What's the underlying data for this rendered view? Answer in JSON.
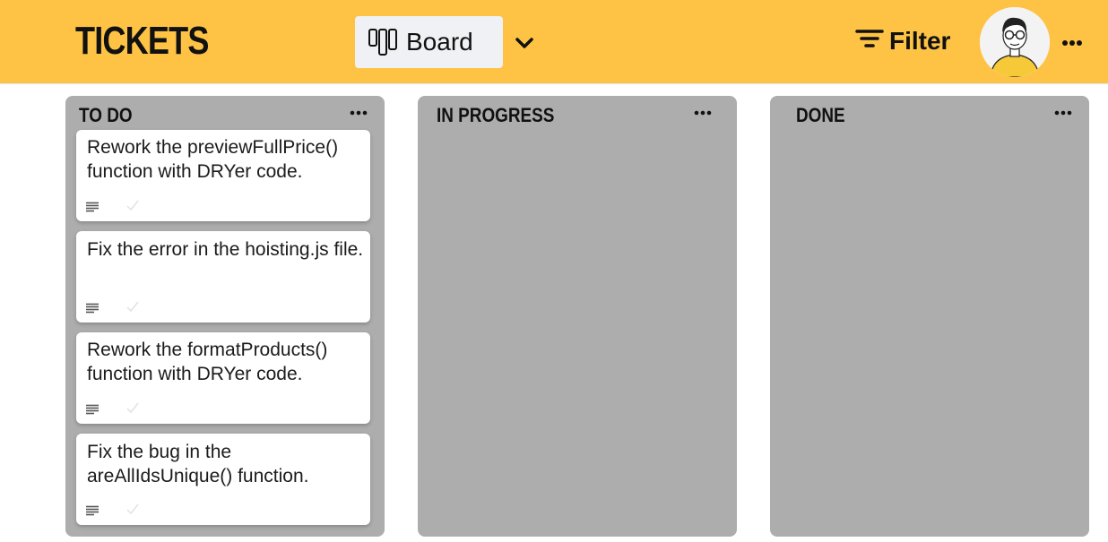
{
  "header": {
    "title": "TICKETS",
    "view_label": "Board",
    "filter_label": "Filter",
    "brand_color": "#FEC345"
  },
  "icons": {
    "view": "board-columns-icon",
    "view_dropdown": "chevron-down-icon",
    "filter": "filter-lines-icon",
    "avatar": "user-avatar",
    "menu": "more-horizontal-icon",
    "card_description": "description-lines-icon",
    "card_status": "checkmark-icon"
  },
  "columns": [
    {
      "title": "TO DO",
      "cards": [
        {
          "text": "Rework the previewFullPrice() function with DRYer code."
        },
        {
          "text": "Fix the error in the hoisting.js file."
        },
        {
          "text": "Rework the formatProducts() function with DRYer code."
        },
        {
          "text": "Fix the bug in the areAllIdsUnique() function."
        }
      ]
    },
    {
      "title": "IN PROGRESS",
      "cards": []
    },
    {
      "title": "DONE",
      "cards": []
    }
  ],
  "colors": {
    "column_bg": "#ADADAD",
    "card_bg": "#FFFFFF",
    "view_button_bg": "#EFF1F4"
  }
}
